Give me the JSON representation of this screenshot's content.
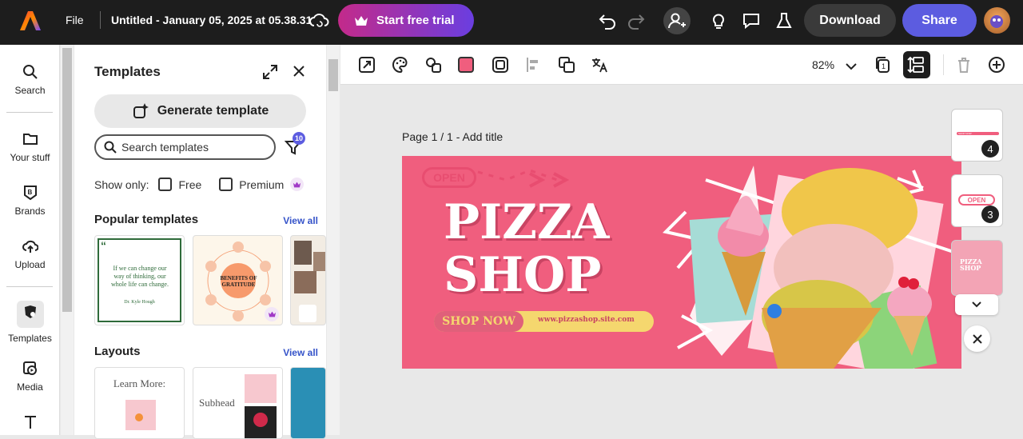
{
  "topbar": {
    "file_label": "File",
    "doc_title": "Untitled - January 05, 2025 at 05.38.31",
    "trial_label": "Start free trial",
    "download_label": "Download",
    "share_label": "Share"
  },
  "leftnav": {
    "items": [
      {
        "label": "Search"
      },
      {
        "label": "Your stuff"
      },
      {
        "label": "Brands"
      },
      {
        "label": "Upload"
      },
      {
        "label": "Templates"
      },
      {
        "label": "Media"
      }
    ]
  },
  "panel": {
    "title": "Templates",
    "generate_label": "Generate template",
    "search_placeholder": "Search templates",
    "filter_count": "10",
    "show_only": "Show only:",
    "free_label": "Free",
    "premium_label": "Premium",
    "popular_heading": "Popular templates",
    "popular_viewall": "View all",
    "layouts_heading": "Layouts",
    "layouts_viewall": "View all",
    "quote_text": "If we can change our way of thinking, our whole life can change.",
    "quote_author": "Dr. Kyle Hough",
    "gratitude_title": "BENEFITS OF GRATITUDE",
    "layout1_text": "Learn More:",
    "layout2_text": "Subhead"
  },
  "canvas": {
    "zoom": "82%",
    "page_label": "Page 1 / 1 -",
    "add_title": "Add title",
    "banner": {
      "open_tag": "OPEN",
      "title_line1": "PIZZA",
      "title_line2": "SHOP",
      "cta": "SHOP NOW",
      "url": "www.pizzashop.site.com"
    },
    "pages": [
      {
        "num": "4",
        "tag": "SHOP NOW"
      },
      {
        "num": "3",
        "tag": "OPEN"
      },
      {
        "num": "",
        "tag": "PIZZA SHOP"
      }
    ]
  },
  "colors": {
    "accent": "#5c5ce0",
    "banner_pink": "#f05e7e",
    "topbar": "#1d1d1d"
  }
}
